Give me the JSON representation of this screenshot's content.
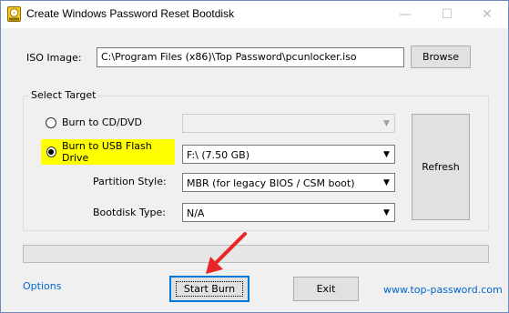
{
  "window": {
    "title": "Create Windows Password Reset Bootdisk",
    "minimize_glyph": "—",
    "maximize_glyph": "☐",
    "close_glyph": "✕"
  },
  "iso": {
    "label": "ISO Image:",
    "path": "C:\\Program Files (x86)\\Top Password\\pcunlocker.iso",
    "browse_label": "Browse"
  },
  "target": {
    "group_title": "Select Target",
    "burn_cd_label": "Burn to CD/DVD",
    "burn_cd_value": "",
    "burn_usb_label": "Burn to USB Flash Drive",
    "burn_usb_value": "F:\\ (7.50 GB)",
    "selected": "usb",
    "partition_label": "Partition Style:",
    "partition_value": "MBR (for legacy BIOS / CSM boot)",
    "bootdisk_label": "Bootdisk Type:",
    "bootdisk_value": "N/A",
    "refresh_label": "Refresh"
  },
  "progress": {
    "value": 0
  },
  "footer": {
    "options_label": "Options",
    "start_label": "Start Burn",
    "exit_label": "Exit",
    "website_label": "www.top-password.com"
  },
  "colors": {
    "highlight": "#ffff00",
    "link": "#0066cc",
    "annotation_arrow": "#e8262a",
    "focus_border": "#0078d7"
  },
  "icons": [
    "iso-disc-app-icon",
    "chevron-down-icon",
    "red-annotation-arrow"
  ]
}
